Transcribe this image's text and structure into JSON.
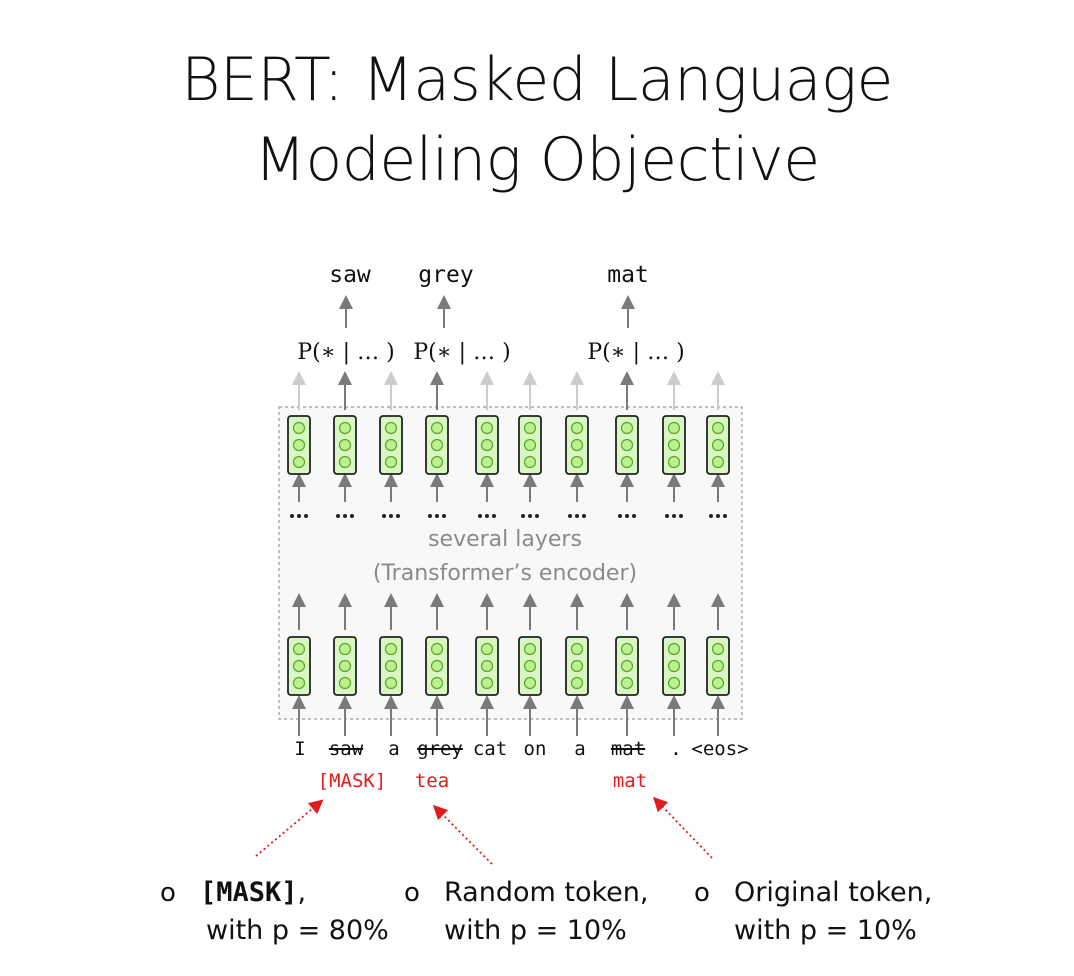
{
  "title": {
    "line1": "BERT: Masked Language",
    "line2": "Modeling Objective"
  },
  "outputs": [
    {
      "word": "saw",
      "prob": "P(∗ | … )"
    },
    {
      "word": "grey",
      "prob": "P(∗ | … )"
    },
    {
      "word": "mat",
      "prob": "P(∗ | … )"
    }
  ],
  "layers_label": {
    "line1": "several layers",
    "line2": "(Transformer’s encoder)"
  },
  "dots": "···",
  "tokens": [
    "I",
    "saw",
    "a",
    "grey",
    "cat",
    "on",
    "a",
    "mat",
    ".",
    "<eos>"
  ],
  "replacements": [
    "[MASK]",
    "tea",
    "mat"
  ],
  "bullets": [
    {
      "line1_bold": "[MASK]",
      "line1_rest": ",",
      "line2": "with p = 80%"
    },
    {
      "line1": "Random token,",
      "line2": "with p = 10%"
    },
    {
      "line1": "Original token,",
      "line2": "with p = 10%"
    }
  ],
  "colors": {
    "accent_red": "#e41a1c",
    "vector_fill": "#d9f7c2",
    "circle_fill": "#bdf08f",
    "circle_stroke": "#5aa52c",
    "arrow_dark": "#7a7a7a",
    "arrow_light": "#cccccc",
    "box_dash": "#999999",
    "box_fill": "#f8f8f8"
  }
}
